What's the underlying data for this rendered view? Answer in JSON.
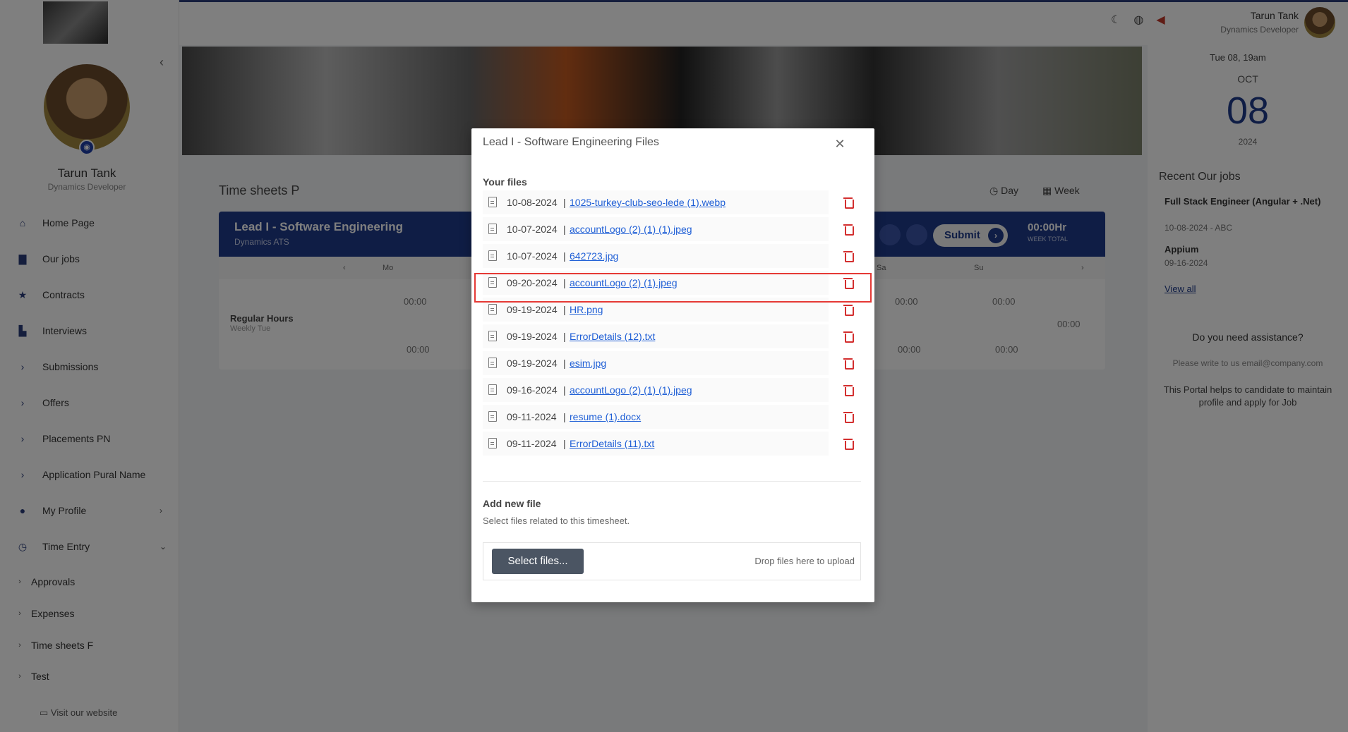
{
  "header": {
    "user_name": "Tarun Tank",
    "user_role": "Dynamics Developer"
  },
  "sidebar": {
    "user_name": "Tarun Tank",
    "user_role": "Dynamics Developer",
    "items": [
      {
        "label": "Home Page",
        "icon": "home-icon"
      },
      {
        "label": "Our jobs",
        "icon": "briefcase-icon"
      },
      {
        "label": "Contracts",
        "icon": "star-icon"
      },
      {
        "label": "Interviews",
        "icon": "chart-icon"
      },
      {
        "label": "Submissions",
        "icon": "chevron-right-icon"
      },
      {
        "label": "Offers",
        "icon": "chevron-right-icon"
      },
      {
        "label": "Placements PN",
        "icon": "chevron-right-icon"
      },
      {
        "label": "Application Pural Name",
        "icon": "chevron-right-icon"
      },
      {
        "label": "My Profile",
        "icon": "user-icon"
      },
      {
        "label": "Time Entry",
        "icon": "clock-icon"
      }
    ],
    "sub_items": [
      "Approvals",
      "Expenses",
      "Time sheets F",
      "Test"
    ],
    "visit_label": "Visit our website"
  },
  "content": {
    "title": "Time sheets P",
    "view_day": "Day",
    "view_week": "Week",
    "timesheet": {
      "title": "Lead I - Software Engineering",
      "subtitle": "Dynamics ATS",
      "submit_label": "Submit",
      "total": "00:00Hr",
      "total_label": "WEEK TOTAL",
      "day_mo": "Mo",
      "day_sa": "Sa",
      "day_su": "Su",
      "row_label": "Regular Hours",
      "row_sub": "Weekly Tue",
      "zero": "00:00"
    }
  },
  "right_panel": {
    "date_small": "Tue 08, 19am",
    "month": "OCT",
    "day": "08",
    "year": "2024",
    "section": "Recent Our jobs",
    "job1": "Full Stack Engineer (Angular + .Net)",
    "job1_sub": "10-08-2024 - ABC",
    "job2": "Appium",
    "job2_sub": "09-16-2024",
    "view_all": "View all",
    "assist": "Do you need assistance?",
    "email": "Please write to us email@company.com",
    "portal": "This Portal helps to candidate to maintain profile and apply for Job"
  },
  "modal": {
    "title": "Lead I - Software Engineering Files",
    "your_files": "Your files",
    "files": [
      {
        "date": "10-08-2024",
        "name": "1025-turkey-club-seo-lede (1).webp"
      },
      {
        "date": "10-07-2024",
        "name": "accountLogo (2) (1) (1).jpeg"
      },
      {
        "date": "10-07-2024",
        "name": "642723.jpg"
      },
      {
        "date": "09-20-2024",
        "name": "accountLogo (2) (1).jpeg"
      },
      {
        "date": "09-19-2024",
        "name": "HR.png"
      },
      {
        "date": "09-19-2024",
        "name": "ErrorDetails (12).txt"
      },
      {
        "date": "09-19-2024",
        "name": "esim.jpg"
      },
      {
        "date": "09-16-2024",
        "name": "accountLogo (2) (1) (1).jpeg"
      },
      {
        "date": "09-11-2024",
        "name": "resume (1).docx"
      },
      {
        "date": "09-11-2024",
        "name": "ErrorDetails (11).txt"
      }
    ],
    "separator": "|",
    "add_title": "Add new file",
    "add_hint": "Select files related to this timesheet.",
    "select_label": "Select files...",
    "drop_label": "Drop files here to upload",
    "colors": {
      "link": "#1f5fd6",
      "delete": "#d32f2f",
      "highlight": "#e53935",
      "primary": "#1e3a8a"
    }
  }
}
